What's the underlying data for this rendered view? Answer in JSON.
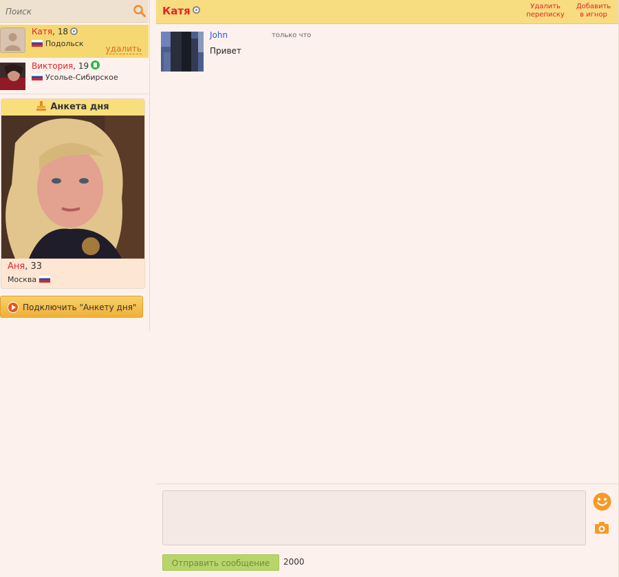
{
  "search": {
    "placeholder": "Поиск"
  },
  "contacts": [
    {
      "name": "Катя",
      "age": "18",
      "city": "Подольск",
      "status": "offline",
      "action": "удалить"
    },
    {
      "name": "Виктория",
      "age": "19",
      "city": "Усолье-Сибирское",
      "status": "mobile"
    }
  ],
  "profile_of_day": {
    "title": "Анкета дня",
    "name": "Аня",
    "age": "33",
    "city": "Москва"
  },
  "connect_button": {
    "label": "Подключить \"Анкету дня\""
  },
  "chat": {
    "title": "Катя",
    "delete_label_line1": "Удалить",
    "delete_label_line2": "переписку",
    "ignore_label_line1": "Добавить",
    "ignore_label_line2": "в игнор"
  },
  "messages": [
    {
      "author": "John",
      "time": "только что",
      "text": "Привет"
    }
  ],
  "compose": {
    "send_label": "Отправить сообщение",
    "char_limit": "2000"
  },
  "colors": {
    "background": "#fcf1ec",
    "header": "#f8dc80",
    "active_contact": "#f6d873",
    "name_red": "#e3232b",
    "send_green": "#b7d56a"
  }
}
